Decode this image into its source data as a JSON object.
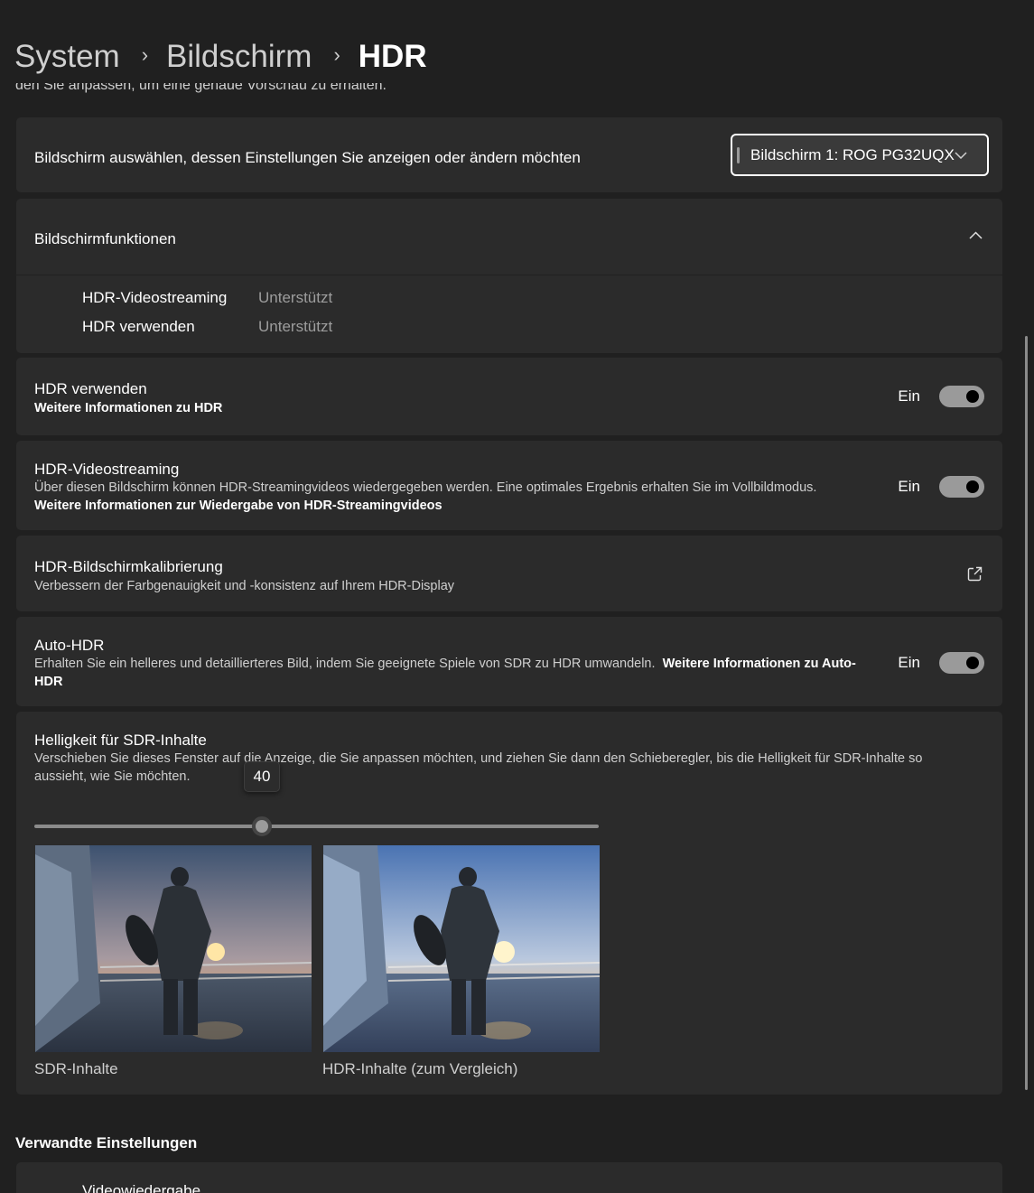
{
  "breadcrumb": {
    "items": [
      "System",
      "Bildschirm"
    ],
    "current": "HDR",
    "separator": "›"
  },
  "cut_text": "den Sie anpassen, um eine genaue Vorschau zu erhalten.",
  "display_select": {
    "label": "Bildschirm auswählen, dessen Einstellungen Sie anzeigen oder ändern möchten",
    "value": "Bildschirm 1: ROG PG32UQX"
  },
  "capabilities": {
    "title": "Bildschirmfunktionen",
    "rows": [
      {
        "name": "HDR-Videostreaming",
        "value": "Unterstützt"
      },
      {
        "name": "HDR verwenden",
        "value": "Unterstützt"
      }
    ]
  },
  "use_hdr": {
    "title": "HDR verwenden",
    "link": "Weitere Informationen zu HDR",
    "state": "Ein"
  },
  "hdr_streaming": {
    "title": "HDR-Videostreaming",
    "desc": "Über diesen Bildschirm können HDR-Streamingvideos wiedergegeben werden. Eine optimales Ergebnis erhalten Sie im Vollbildmodus.",
    "link": "Weitere Informationen zur Wiedergabe von HDR-Streamingvideos",
    "state": "Ein"
  },
  "calibration": {
    "title": "HDR-Bildschirmkalibrierung",
    "desc": "Verbessern der Farbgenauigkeit und -konsistenz auf Ihrem HDR-Display"
  },
  "auto_hdr": {
    "title": "Auto-HDR",
    "desc": "Erhalten Sie ein helleres und detaillierteres Bild, indem Sie geeignete Spiele von SDR zu HDR umwandeln.",
    "link": "Weitere Informationen zu Auto-HDR",
    "state": "Ein"
  },
  "sdr_brightness": {
    "title": "Helligkeit für SDR-Inhalte",
    "desc": "Verschieben Sie dieses Fenster auf die Anzeige, die Sie anpassen möchten, und ziehen Sie dann den Schieberegler, bis die Helligkeit für SDR-Inhalte so aussieht, wie Sie möchten.",
    "value": "40",
    "sdr_caption": "SDR-Inhalte",
    "hdr_caption": "HDR-Inhalte (zum Vergleich)"
  },
  "related": {
    "title": "Verwandte Einstellungen",
    "first_item": "Videowiedergabe"
  },
  "colors": {
    "background": "#202020",
    "card": "#2b2b2b",
    "toggle_on": "#9a9a9a"
  }
}
